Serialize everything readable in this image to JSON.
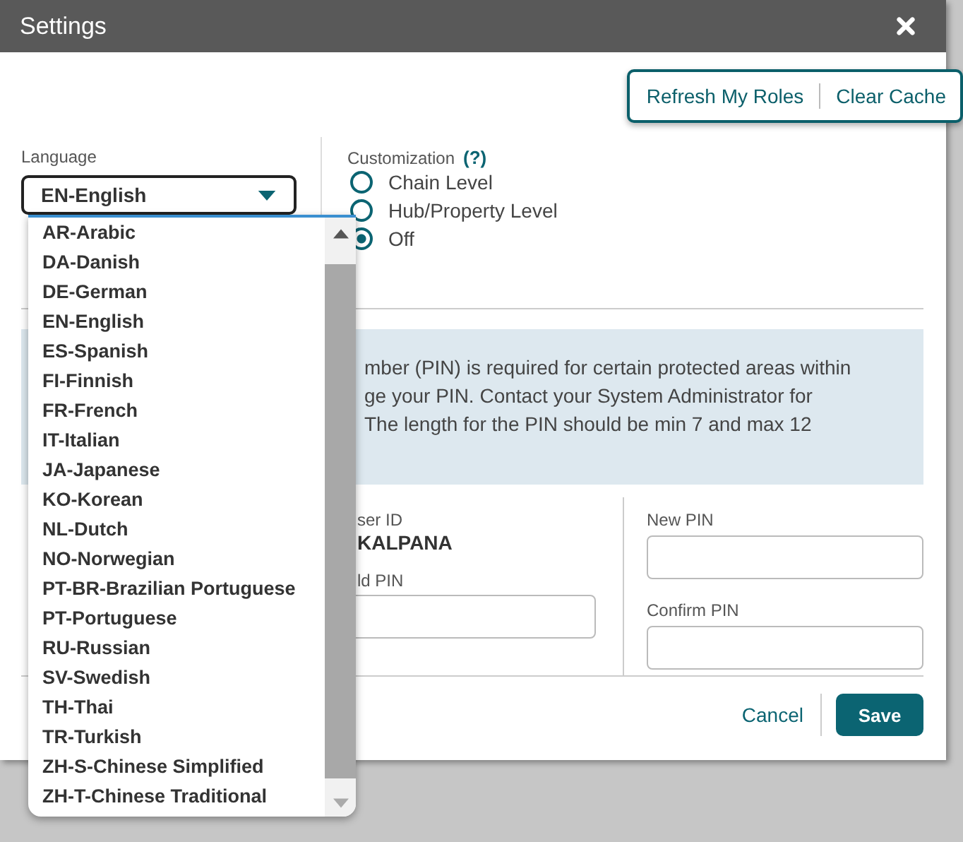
{
  "window": {
    "title": "Settings"
  },
  "header_actions": [
    {
      "label": "Refresh My Roles"
    },
    {
      "label": "Clear Cache"
    }
  ],
  "language": {
    "label": "Language",
    "value": "EN-English",
    "expanded": true,
    "options": [
      {
        "label": "AR-Arabic"
      },
      {
        "label": "DA-Danish"
      },
      {
        "label": "DE-German"
      },
      {
        "label": "EN-English"
      },
      {
        "label": "ES-Spanish"
      },
      {
        "label": "FI-Finnish"
      },
      {
        "label": "FR-French"
      },
      {
        "label": "IT-Italian"
      },
      {
        "label": "JA-Japanese"
      },
      {
        "label": "KO-Korean"
      },
      {
        "label": "NL-Dutch"
      },
      {
        "label": "NO-Norwegian"
      },
      {
        "label": "PT-BR-Brazilian Portuguese"
      },
      {
        "label": "PT-Portuguese"
      },
      {
        "label": "RU-Russian"
      },
      {
        "label": "SV-Swedish"
      },
      {
        "label": "TH-Thai"
      },
      {
        "label": "TR-Turkish"
      },
      {
        "label": "ZH-S-Chinese Simplified"
      },
      {
        "label": "ZH-T-Chinese Traditional"
      }
    ]
  },
  "customization": {
    "label": "Customization",
    "help": "(?)",
    "options": [
      {
        "label": "Chain Level",
        "selected": false
      },
      {
        "label": "Hub/Property Level",
        "selected": false
      },
      {
        "label": "Off",
        "selected": true
      }
    ]
  },
  "pin": {
    "info_lines": [
      "mber (PIN) is required for certain protected areas within",
      "ge your PIN. Contact your System Administrator for",
      "The length for the PIN should be min 7 and max 12"
    ],
    "user_id_label": "ser ID",
    "user_id": "KALPANA",
    "old_pin_label": "ld PIN",
    "new_pin_label": "New PIN",
    "confirm_pin_label": "Confirm PIN"
  },
  "buttons": [
    {
      "label": "Cancel",
      "kind": "link"
    },
    {
      "label": "Save",
      "kind": "primary"
    }
  ]
}
